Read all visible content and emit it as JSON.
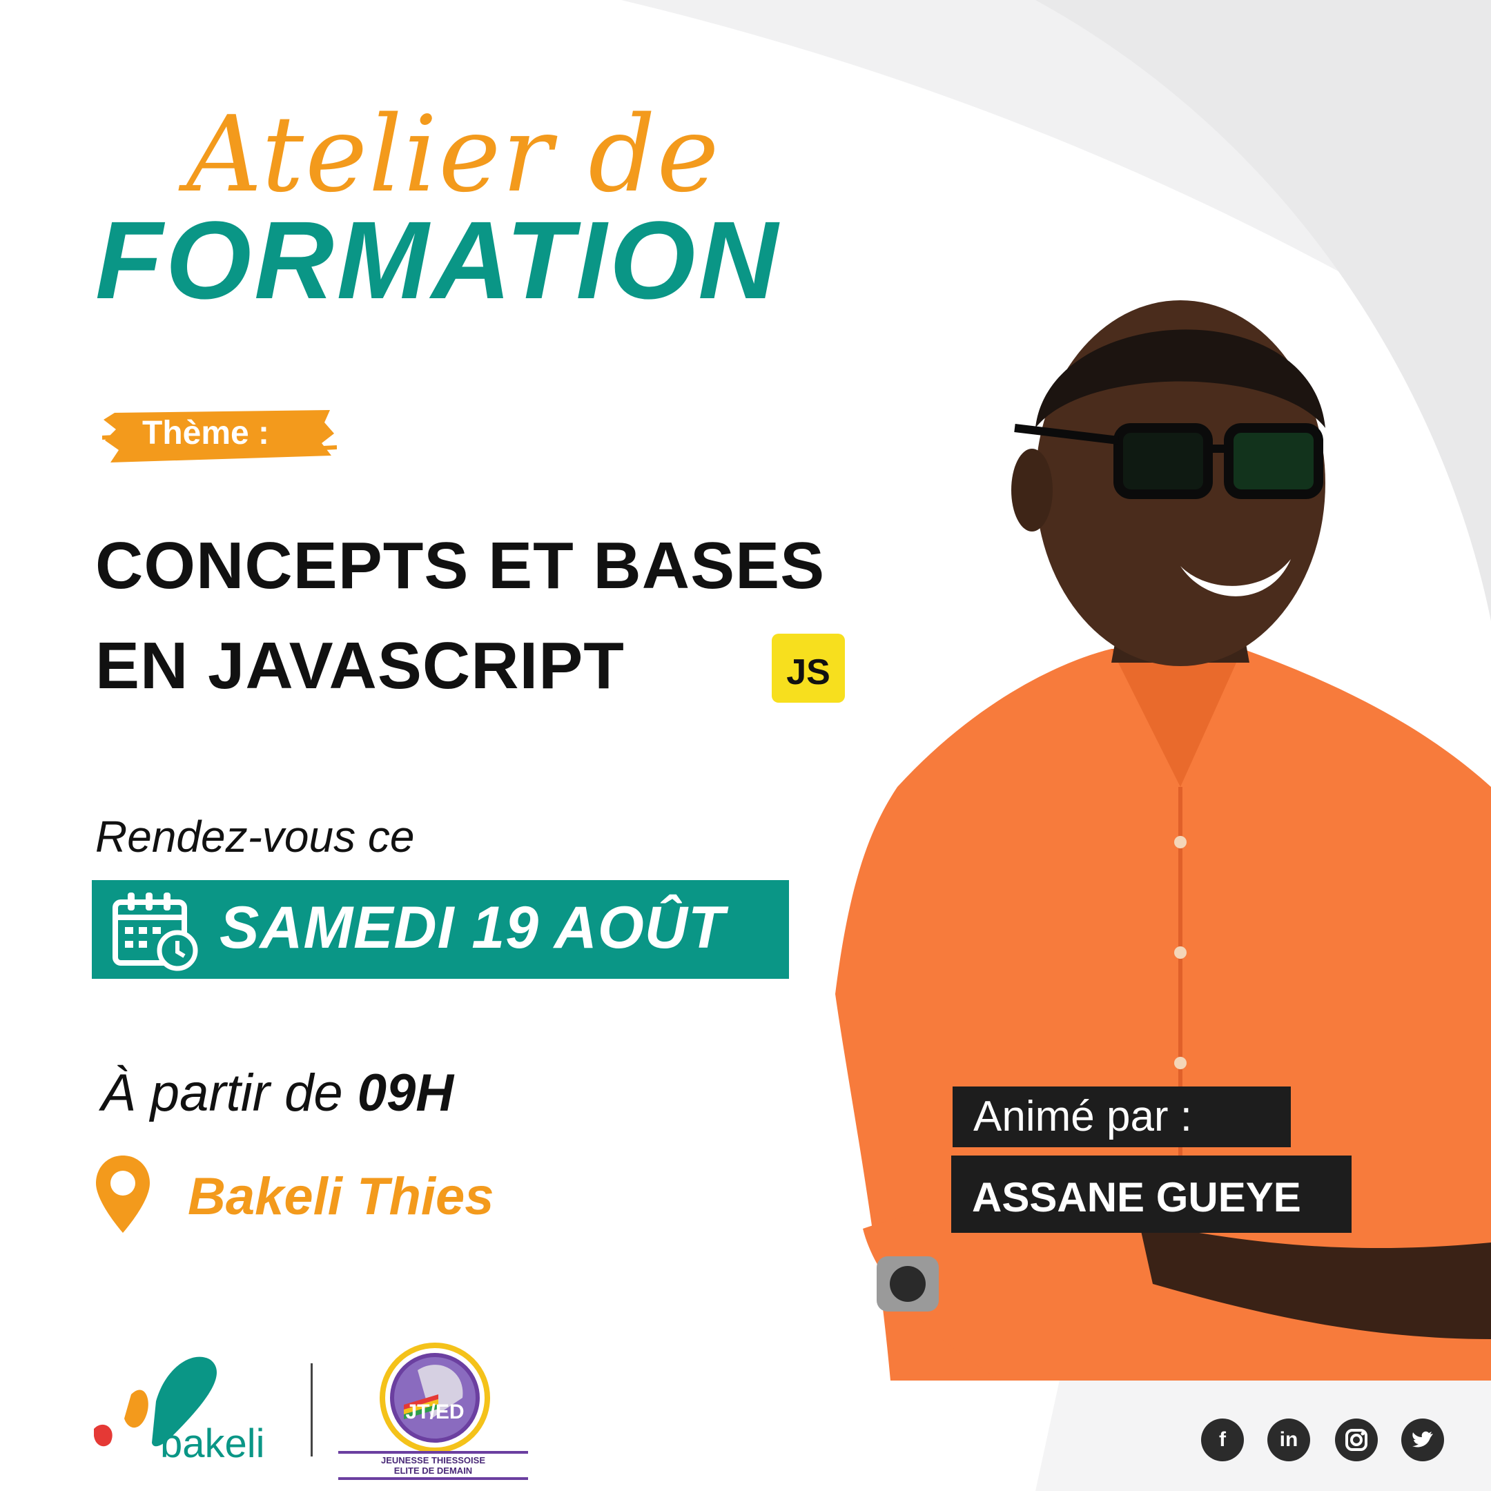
{
  "header": {
    "script_title": "Atelier de",
    "main_title": "FORMATION"
  },
  "theme": {
    "label": "Thème :",
    "line1": "CONCEPTS ET BASES",
    "line2": "EN JAVASCRIPT",
    "badge": "JS"
  },
  "schedule": {
    "intro": "Rendez-vous ce",
    "date": "SAMEDI 19 AOÛT",
    "time_prefix": "À partir de",
    "time_value": "09H",
    "location": "Bakeli Thies"
  },
  "host": {
    "label": "Animé par :",
    "name": "ASSANE GUEYE"
  },
  "footer": {
    "brand": "bakeli",
    "partner_logo_text": "JT/ED",
    "partner_line1": "JEUNESSE THIESSOISE",
    "partner_line2": "ELITE DE DEMAIN",
    "social_icons": [
      "facebook-icon",
      "linkedin-icon",
      "instagram-icon",
      "twitter-icon"
    ]
  },
  "colors": {
    "teal": "#0a9686",
    "orange": "#f39a1c",
    "shirt": "#f77b3c",
    "js_yellow": "#f7df1e",
    "dark": "#1d1d1d"
  }
}
